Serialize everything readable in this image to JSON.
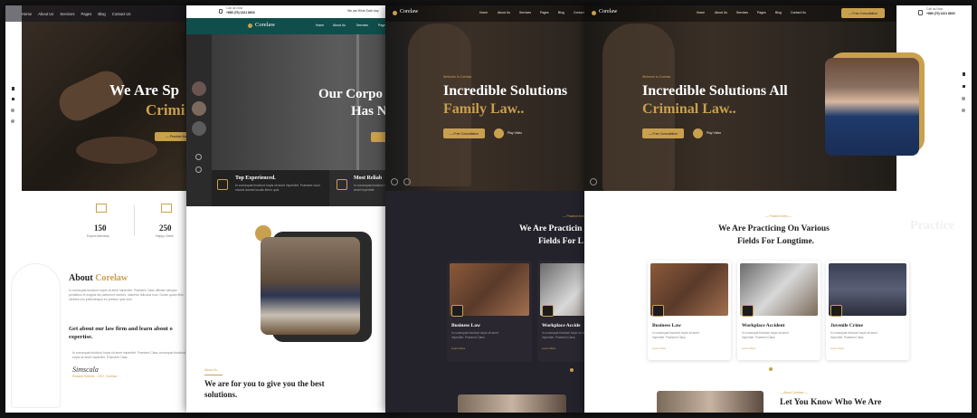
{
  "nav": {
    "items": [
      "Home",
      "About Us",
      "Services",
      "Pages",
      "Blog",
      "Contact Us"
    ],
    "teal_items": [
      "Home",
      "About Us",
      "Services",
      "Pages"
    ]
  },
  "brand": {
    "logo_text": "Corelaw"
  },
  "topbar": {
    "call_label": "Call us Now",
    "phone": "+880 (70) 1321 8630",
    "right_text": "We are Work Each day"
  },
  "p1": {
    "hero_line1": "We Are Sp",
    "hero_line2": "Crimi",
    "cta": "— Practice Area",
    "stats": [
      {
        "num": "150",
        "label": "Expert Attorneys"
      },
      {
        "num": "250",
        "label": "Happy Client"
      }
    ],
    "about_title_a": "About ",
    "about_title_b": "Corelaw",
    "about_para": "In consequat tincidunt turpis sit amet imperdiet. Praesent Class officiae natoque penatibus et magnis dis parturient montes, nascetur ridiculus mus. Donec quam felis ultricies nec pellentesque eu pretium quis sem.",
    "about_bold": "Get about our law firm and learn about o expertise.",
    "sig_para": "In consequat tincidunt turpis sit amet imperdiet. Praesent Class consequat tincidunt turpis sit amet imperdiet. Praesent Class",
    "signature": "Simscala",
    "sig_role": "Rosaria Roberts - CEO, Corelaw"
  },
  "p2": {
    "hero_line1": "Our Corpo",
    "hero_line2": "Has N",
    "feature1_title": "Top Experienced.",
    "feature1_text": "In consequat tincidunt turpis sit amet imperdiet. Praesent sucd mauris laoreet iaculis libero quis.",
    "feature2_title": "Most Reliab",
    "feature2_text": "In consequat tincidunt turpis sit amet imperdiet.",
    "section_kicker": "About Us",
    "section_title": "We are for you to give you the best solutions."
  },
  "p3": {
    "welcome": "Welcome to Corelaw",
    "hero_line1": "Incredible Solutions",
    "hero_line2": "Family Law..",
    "cta": "— Free Consultation",
    "play": "Play Video",
    "kicker": "— Practice Area",
    "section_title_1": "We Are Practicin",
    "section_title_2": "Fields For L",
    "cards": [
      {
        "title": "Business Law",
        "desc": "In consequat tincidunt turpis sit amet imperdiet. Praesent Class.",
        "more": "Learn More"
      },
      {
        "title": "Workplace Accide",
        "desc": "In consequat tincidunt turpis sit amet imperdiet. Praesent Class.",
        "more": "Learn More"
      }
    ]
  },
  "p4": {
    "cta_top": "— Free Consultation",
    "welcome": "Welcome to Corelaw",
    "hero_line1": "Incredible Solutions All",
    "hero_line2": "Criminal Law..",
    "cta": "— Free Consultation",
    "play": "Play Video",
    "kicker": "— Practice Area —",
    "section_title_1": "We Are Practicing On Various",
    "section_title_2": "Fields For Longtime.",
    "watermark": "Practice",
    "cards": [
      {
        "title": "Business Law",
        "desc": "In consequat tincidunt turpis sit amet imperdiet. Praesent Class.",
        "more": "Learn More"
      },
      {
        "title": "Workplace Accident",
        "desc": "In consequat tincidunt turpis sit amet imperdiet. Praesent Class.",
        "more": "Learn More"
      },
      {
        "title": "Juvenile Crime",
        "desc": "In consequat tincidunt turpis sit amet imperdiet. Praesent Class.",
        "more": "Learn More"
      }
    ],
    "kicker2": "— About Corelaw —",
    "section2_title": "Let You Know Who We Are"
  },
  "colors": {
    "gold": "#c9a04e",
    "dark": "#24222a",
    "teal": "#0f4e4b"
  }
}
